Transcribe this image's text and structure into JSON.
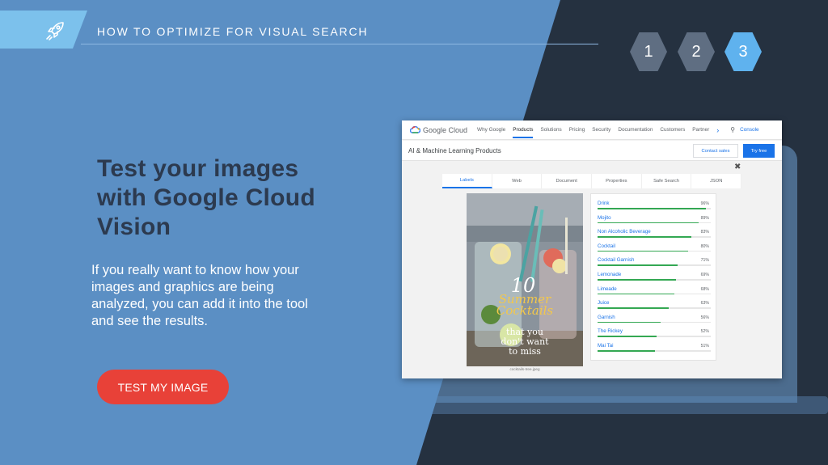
{
  "header": {
    "title": "HOW TO OPTIMIZE FOR VISUAL SEARCH",
    "icon": "rocket-icon",
    "steps": [
      "1",
      "2",
      "3"
    ],
    "active_step": "3"
  },
  "hero": {
    "title": "Test your images with Google Cloud Vision",
    "body": "If you really want to know how your images and graphics are being analyzed, you can add it into the tool and see the results.",
    "cta_label": "TEST MY IMAGE"
  },
  "colors": {
    "blue_panel": "#5b8fc4",
    "dark_panel": "#253140",
    "cta": "#e84138",
    "step_active": "#5fb2ee",
    "step_inactive": "#5f6e82"
  },
  "screenshot": {
    "logo_text": "Google Cloud",
    "nav": [
      "Why Google",
      "Products",
      "Solutions",
      "Pricing",
      "Security",
      "Documentation",
      "Customers",
      "Partner"
    ],
    "nav_active": "Products",
    "console": "Console",
    "section_title": "AI & Machine Learning Products",
    "contact_sales": "Contact sales",
    "try_free": "Try free",
    "close": "✖",
    "tabs": [
      "Labels",
      "Web",
      "Document",
      "Properties",
      "Safe Search",
      "JSON"
    ],
    "tab_active": "Labels",
    "poster": {
      "number": "10",
      "line1": "Summer",
      "line2": "Cocktails",
      "line3": "that you",
      "line4": "don't want",
      "line5": "to miss"
    },
    "image_caption": "cocktails-tree.jpeg",
    "labels": [
      {
        "name": "Drink",
        "score": "96%"
      },
      {
        "name": "Mojito",
        "score": "89%"
      },
      {
        "name": "Non Alcoholic Beverage",
        "score": "83%"
      },
      {
        "name": "Cocktail",
        "score": "80%"
      },
      {
        "name": "Cocktail Garnish",
        "score": "71%"
      },
      {
        "name": "Lemonade",
        "score": "69%"
      },
      {
        "name": "Limeade",
        "score": "68%"
      },
      {
        "name": "Juice",
        "score": "63%"
      },
      {
        "name": "Garnish",
        "score": "56%"
      },
      {
        "name": "The Rickey",
        "score": "52%"
      },
      {
        "name": "Mai Tai",
        "score": "51%"
      }
    ]
  }
}
